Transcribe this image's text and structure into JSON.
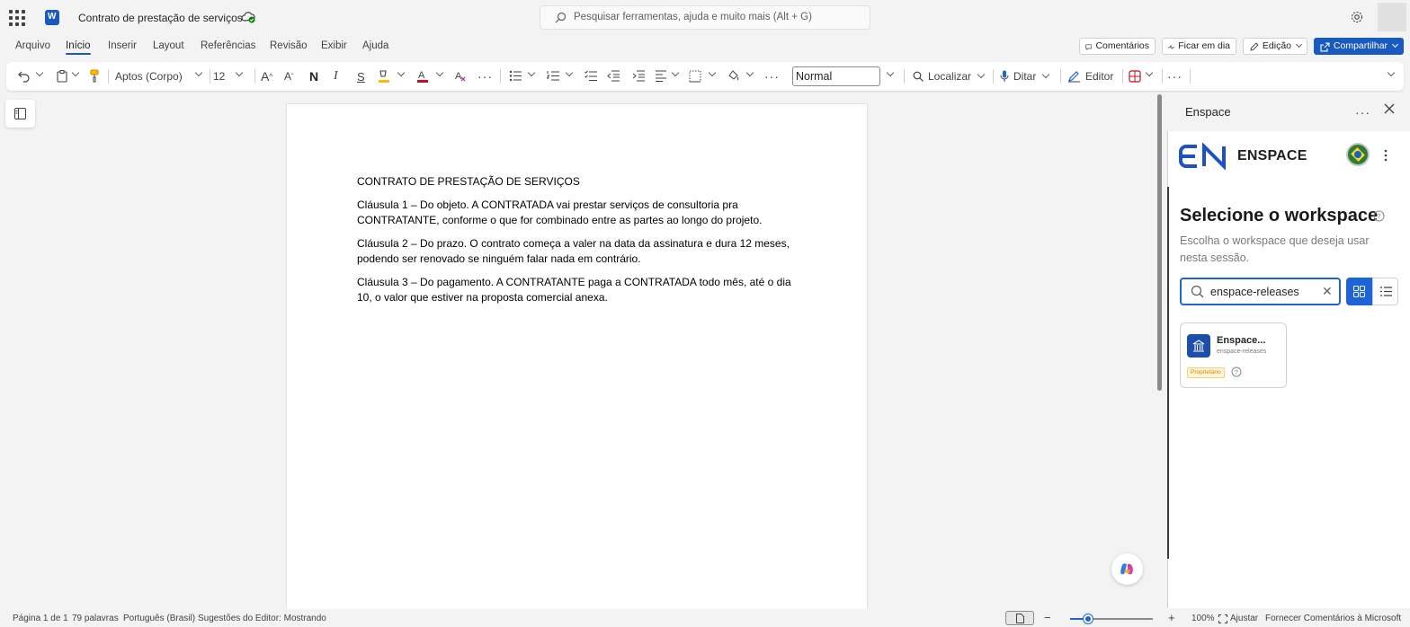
{
  "app": {
    "doc_title": "Contrato de prestação de serviços",
    "search_placeholder": "Pesquisar ferramentas, ajuda e muito mais (Alt + G)"
  },
  "menu": {
    "items": [
      "Arquivo",
      "Início",
      "Inserir",
      "Layout",
      "Referências",
      "Revisão",
      "Exibir",
      "Ajuda"
    ],
    "active": "Início",
    "comments": "Comentários",
    "catch_up": "Ficar em dia",
    "editing": "Edição",
    "share": "Compartilhar"
  },
  "ribbon": {
    "font_name": "Aptos (Corpo)",
    "font_size": "12",
    "style": "Normal",
    "find": "Localizar",
    "dictate": "Ditar",
    "editor": "Editor",
    "accent_color": "#185abd",
    "font_color_swatch": "#c50f1f",
    "highlight_swatch": "#ffb900"
  },
  "document": {
    "heading": "CONTRATO DE PRESTAÇÃO DE SERVIÇOS",
    "clauses": [
      "Cláusula 1 – Do objeto. A CONTRATADA vai prestar serviços de consultoria pra CONTRATANTE, conforme o que for combinado entre as partes ao longo do projeto.",
      "Cláusula 2 – Do prazo. O contrato começa a valer na data da assinatura e dura 12 meses, podendo ser renovado se ninguém falar nada em contrário.",
      "Cláusula 3 – Do pagamento. A CONTRATANTE paga a CONTRATADA todo mês, até o dia 10, o valor que estiver na proposta comercial anexa."
    ]
  },
  "panel": {
    "title": "Enspace",
    "brand_mark": "EN",
    "brand_name": "ENSPACE",
    "heading": "Selecione o workspace",
    "subtitle": "Escolha o workspace que deseja usar nesta sessão.",
    "search_value": "enspace-releases",
    "card": {
      "name": "Enspace...",
      "slug": "enspace-releases",
      "badge": "Proprietário"
    }
  },
  "status": {
    "page": "Página 1 de 1",
    "words": "79 palavras",
    "language": "Português (Brasil)",
    "suggestions": "Sugestões do Editor: Mostrando",
    "zoom": "100%",
    "fit": "Ajustar",
    "feedback": "Fornecer Comentários à Microsoft",
    "zoom_fraction": 0.22
  }
}
